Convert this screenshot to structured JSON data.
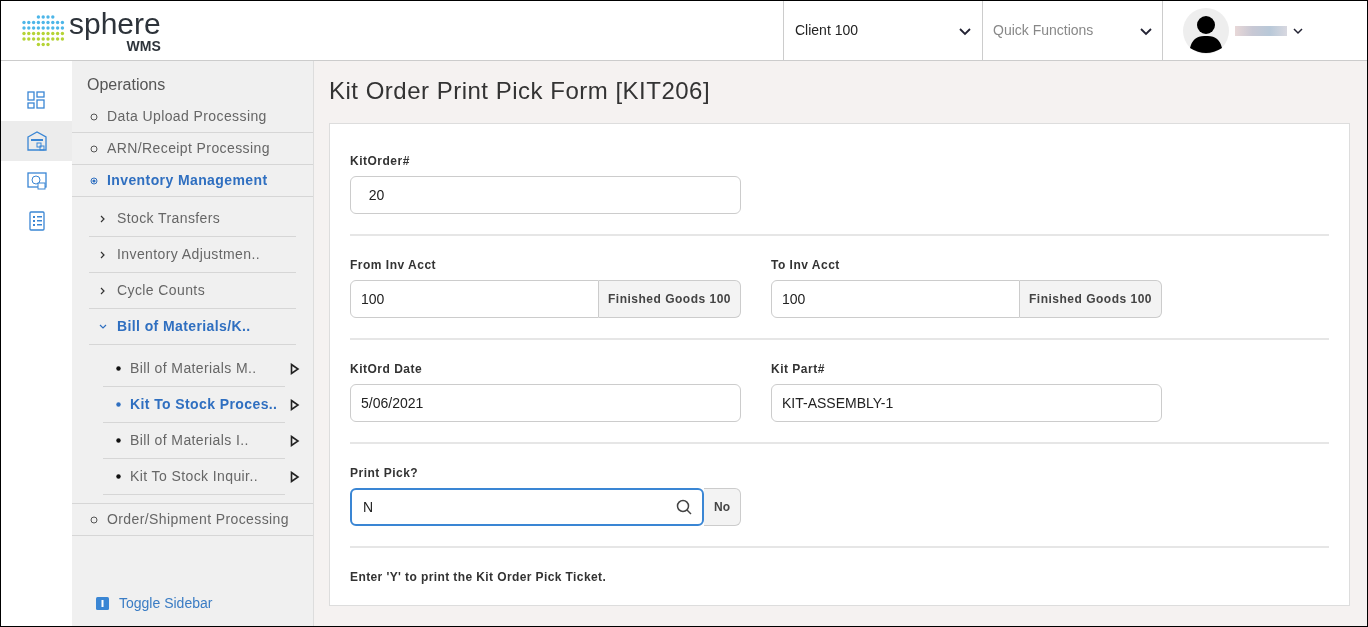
{
  "header": {
    "logo": {
      "name": "sphere",
      "sub": "WMS"
    },
    "client_select": {
      "value": "Client 100"
    },
    "quick_functions": {
      "placeholder": "Quick Functions"
    }
  },
  "rail": [
    {
      "kind": "dashboard",
      "selected": false
    },
    {
      "kind": "warehouse",
      "selected": true
    },
    {
      "kind": "reports",
      "selected": false
    },
    {
      "kind": "checklist",
      "selected": false
    }
  ],
  "sidebar": {
    "title": "Operations",
    "items": [
      {
        "label": "Data Upload Processing",
        "selected": false
      },
      {
        "label": "ARN/Receipt Processing",
        "selected": false
      },
      {
        "label": "Inventory Management",
        "selected": true,
        "children": [
          {
            "label": "Stock Transfers",
            "selected": false,
            "expanded": false
          },
          {
            "label": "Inventory Adjustmen..",
            "selected": false,
            "expanded": false
          },
          {
            "label": "Cycle Counts",
            "selected": false,
            "expanded": false
          },
          {
            "label": "Bill of Materials/K..",
            "selected": true,
            "expanded": true,
            "children": [
              {
                "label": "Bill of Materials M..",
                "selected": false
              },
              {
                "label": "Kit To Stock Proces..",
                "selected": true
              },
              {
                "label": "Bill of Materials I..",
                "selected": false
              },
              {
                "label": "Kit To Stock Inquir..",
                "selected": false
              }
            ]
          }
        ]
      },
      {
        "label": "Order/Shipment Processing",
        "selected": false
      }
    ],
    "toggle": "Toggle Sidebar"
  },
  "page_title": "Kit Order Print Pick Form [KIT206]",
  "sections": [
    {
      "fields": [
        {
          "kind": "text",
          "label": "KitOrder#",
          "value": "  20"
        }
      ]
    },
    {
      "fields": [
        {
          "kind": "lookup",
          "label": "From Inv Acct",
          "value": "100",
          "description": "Finished Goods 100"
        },
        {
          "kind": "lookup",
          "label": "To Inv Acct",
          "value": "100",
          "description": "Finished Goods 100"
        }
      ]
    },
    {
      "fields": [
        {
          "kind": "text",
          "label": "KitOrd Date",
          "value": "5/06/2021"
        },
        {
          "kind": "text",
          "label": "Kit Part#",
          "value": "KIT-ASSEMBLY-1"
        }
      ]
    },
    {
      "fields": [
        {
          "kind": "search",
          "label": "Print Pick?",
          "value": "N",
          "description": "No",
          "focused": true
        }
      ]
    },
    {
      "note": "Enter 'Y' to print the Kit Order Pick Ticket."
    }
  ]
}
